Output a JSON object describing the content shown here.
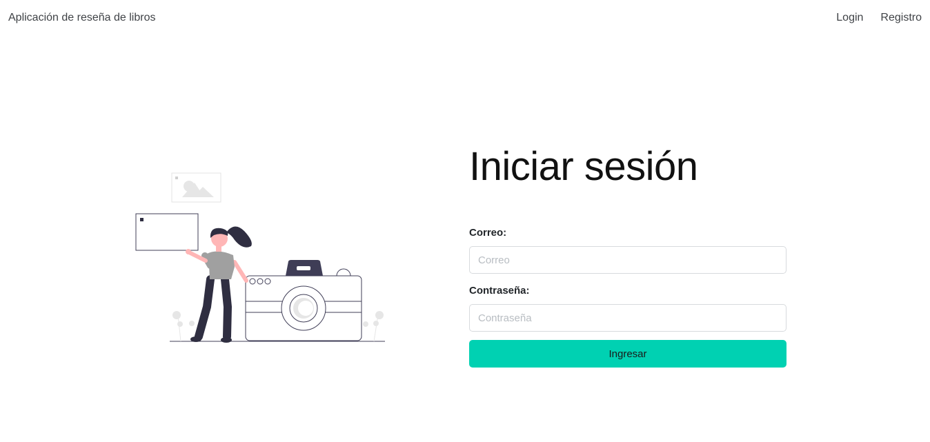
{
  "navbar": {
    "brand": "Aplicación de reseña de libros",
    "links": [
      "Login",
      "Registro"
    ]
  },
  "login": {
    "title": "Iniciar sesión",
    "email": {
      "label": "Correo:",
      "placeholder": "Correo",
      "value": ""
    },
    "password": {
      "label": "Contraseña:",
      "placeholder": "Contraseña",
      "value": ""
    },
    "submit_label": "Ingresar"
  },
  "colors": {
    "accent": "#00d1b2",
    "illustration_dark": "#2f2e41",
    "illustration_skin": "#ffb6b6",
    "illustration_shirt": "#a0a0a0"
  }
}
